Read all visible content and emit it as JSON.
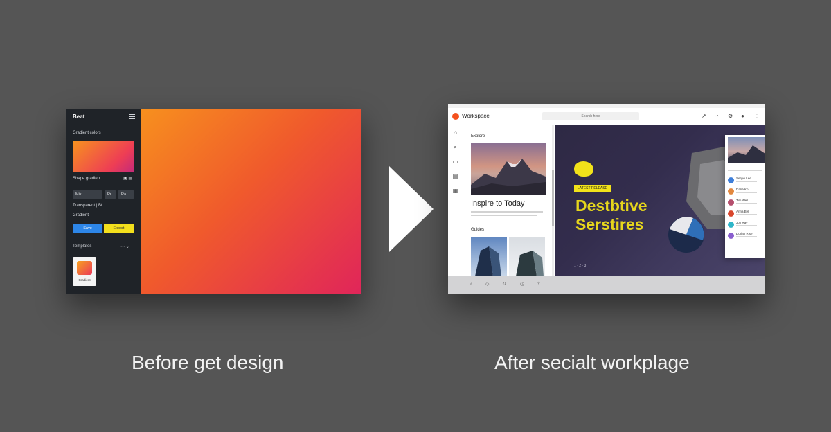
{
  "before": {
    "app_name": "Beat",
    "section_label": "Gradient colors",
    "thumb_caption": "Shape gradient",
    "chips": [
      "Mix",
      "Rr",
      "Ra"
    ],
    "options": [
      "Transparent | Bt",
      "Gradient"
    ],
    "primary_button": "Save",
    "secondary_button": "Export",
    "templates_label": "Templates",
    "card_label": "Gradient",
    "colors": {
      "start": "#f7901e",
      "end": "#e0255a"
    }
  },
  "after": {
    "app_title": "Workspace",
    "search_placeholder": "Search here",
    "feed": {
      "header": "Explore",
      "post_title": "Inspire to Today",
      "section": "Guides"
    },
    "hero": {
      "label": "LATEST RELEASE",
      "title_line1": "Destbtive",
      "title_line2": "Serstires",
      "small_text": "1 · 2 · 3"
    },
    "panel": {
      "people": [
        "Sergio Lee",
        "Daria Ko",
        "Tim Weil",
        "Anna Bell",
        "Jon Ray",
        "Dorian Rise"
      ]
    },
    "accent": "#f2e21a"
  },
  "captions": {
    "before": "Before get design",
    "after": "After secialt workplage"
  }
}
